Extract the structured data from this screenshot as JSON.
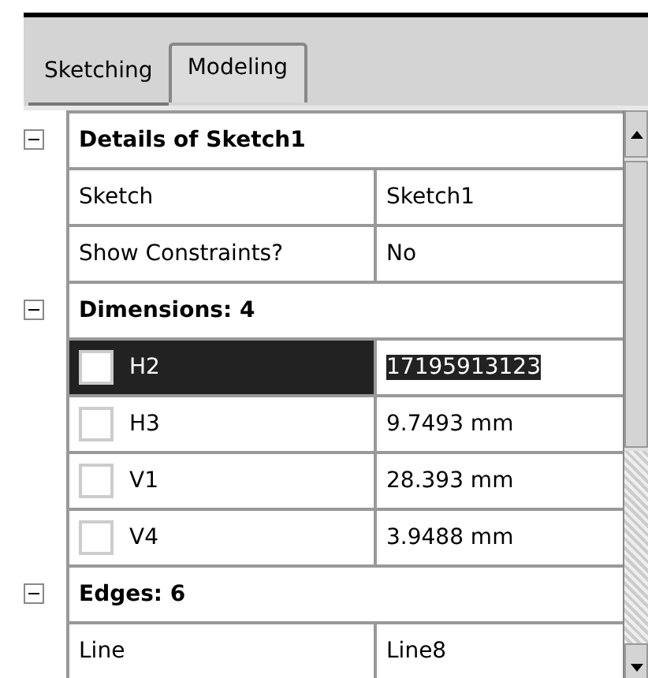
{
  "tabs": [
    {
      "label": "Sketching",
      "selected": false
    },
    {
      "label": "Modeling",
      "selected": true
    }
  ],
  "groups": [
    {
      "title": "Details of Sketch1",
      "expanded": true,
      "rows": [
        {
          "kind": "property",
          "name": "Sketch",
          "value": "Sketch1"
        },
        {
          "kind": "property",
          "name": "Show Constraints?",
          "value": "No"
        }
      ]
    },
    {
      "title": "Dimensions: 4",
      "expanded": true,
      "rows": [
        {
          "kind": "dimension",
          "name": "H2",
          "value": "17195913123",
          "checked": false,
          "selected": true
        },
        {
          "kind": "dimension",
          "name": "H3",
          "value": "9.7493 mm",
          "checked": false,
          "selected": false
        },
        {
          "kind": "dimension",
          "name": "V1",
          "value": "28.393 mm",
          "checked": false,
          "selected": false
        },
        {
          "kind": "dimension",
          "name": "V4",
          "value": "3.9488 mm",
          "checked": false,
          "selected": false
        }
      ]
    },
    {
      "title": "Edges: 6",
      "expanded": true,
      "rows": [
        {
          "kind": "property",
          "name": "Line",
          "value": "Line8"
        }
      ]
    }
  ]
}
